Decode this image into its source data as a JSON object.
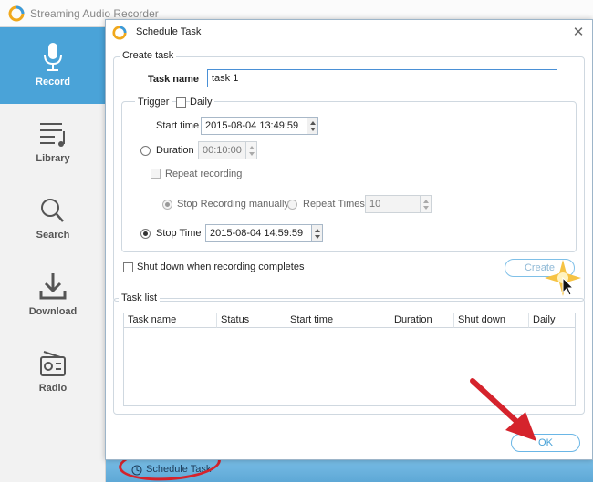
{
  "app": {
    "title": "Streaming Audio Recorder",
    "sidebar": [
      {
        "label": "Record",
        "icon": "microphone-icon",
        "active": true
      },
      {
        "label": "Library",
        "icon": "music-list-icon"
      },
      {
        "label": "Search",
        "icon": "search-icon"
      },
      {
        "label": "Download",
        "icon": "download-icon"
      },
      {
        "label": "Radio",
        "icon": "radio-icon"
      }
    ],
    "schedule_link": "Schedule Task"
  },
  "dialog": {
    "title": "Schedule Task",
    "create_group": "Create task",
    "task_name_label": "Task name",
    "task_name_value": "task 1",
    "trigger_label": "Trigger",
    "daily_label": "Daily",
    "start_time_label": "Start time",
    "start_time_value": "2015-08-04 13:49:59",
    "duration_label": "Duration",
    "duration_value": "00:10:00",
    "repeat_recording_label": "Repeat recording",
    "stop_manually_label": "Stop Recording manually",
    "repeat_times_label": "Repeat Times",
    "repeat_times_value": "10",
    "stop_time_label": "Stop Time",
    "stop_time_value": "2015-08-04 14:59:59",
    "shutdown_label": "Shut down when recording completes",
    "create_button": "Create",
    "task_list_group": "Task list",
    "columns": [
      "Task name",
      "Status",
      "Start time",
      "Duration",
      "Shut down",
      "Daily"
    ],
    "ok_button": "OK"
  },
  "colors": {
    "accent": "#4aa3d8",
    "annotation": "#d5232c"
  }
}
